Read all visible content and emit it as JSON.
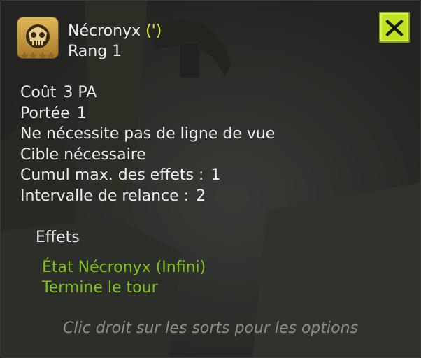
{
  "spell": {
    "name": "Nécronyx",
    "name_suffix": "(')",
    "rank": "Rang 1",
    "icon": "skull-icon"
  },
  "close_icon": "close-x-icon",
  "stats": [
    {
      "label": "Coût",
      "value": "3 PA"
    },
    {
      "label": "Portée",
      "value": "1"
    },
    {
      "label": "Ne nécessite pas de ligne de vue",
      "value": ""
    },
    {
      "label": "Cible nécessaire",
      "value": ""
    },
    {
      "label": "Cumul max. des effets :",
      "value": "1"
    },
    {
      "label": "Intervalle de relance :",
      "value": "2"
    }
  ],
  "effects": {
    "heading": "Effets",
    "items": [
      "État Nécronyx (Infini)",
      "Termine le tour"
    ]
  },
  "hint": "Clic droit sur les sorts pour les options",
  "colors": {
    "panel_bg": "#1e1f1c",
    "text": "#ececec",
    "accent_yellow": "#e4e82a",
    "effect_green": "#7fc21d",
    "hint_gray": "#8c8d89",
    "close_button": "#bde31f"
  }
}
